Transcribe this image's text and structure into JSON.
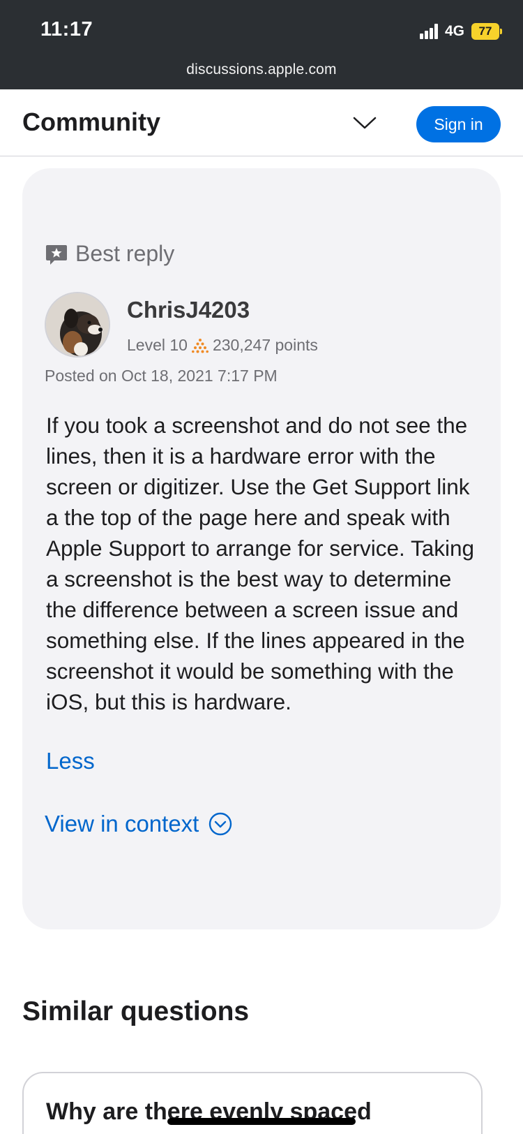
{
  "status_bar": {
    "time": "11:17",
    "network": "4G",
    "battery": "77",
    "url": "discussions.apple.com"
  },
  "header": {
    "title": "Community",
    "sign_in_label": "Sign in",
    "menu_icon": "chevron-down-icon"
  },
  "reply": {
    "badge_label": "Best reply",
    "badge_icon": "star-speech-bubble-icon",
    "username": "ChrisJ4203",
    "level": "Level 10",
    "points": "230,247 points",
    "level_icon": "pyramid-dots-icon",
    "posted": "Posted on Oct 18, 2021 7:17 PM",
    "body": "If you took a screenshot and do not see the lines, then it is a hardware error with the screen or digitizer. Use the Get Support link a the top of the page here and speak with Apple Support to arrange for service. Taking a screenshot is the best way to determine the difference between a screen issue and something else. If the lines appeared in the screenshot it would be something with the iOS, but this is hardware.",
    "less_label": "Less",
    "view_context_label": "View in context",
    "view_context_icon": "chevron-circle-down-icon"
  },
  "similar": {
    "title": "Similar questions",
    "first_question": "Why are there evenly spaced"
  },
  "colors": {
    "accent": "#0071e3",
    "link": "#0066cc",
    "chrome": "#2b2f33",
    "card_bg": "#f3f3f6",
    "battery": "#f7d22b"
  }
}
